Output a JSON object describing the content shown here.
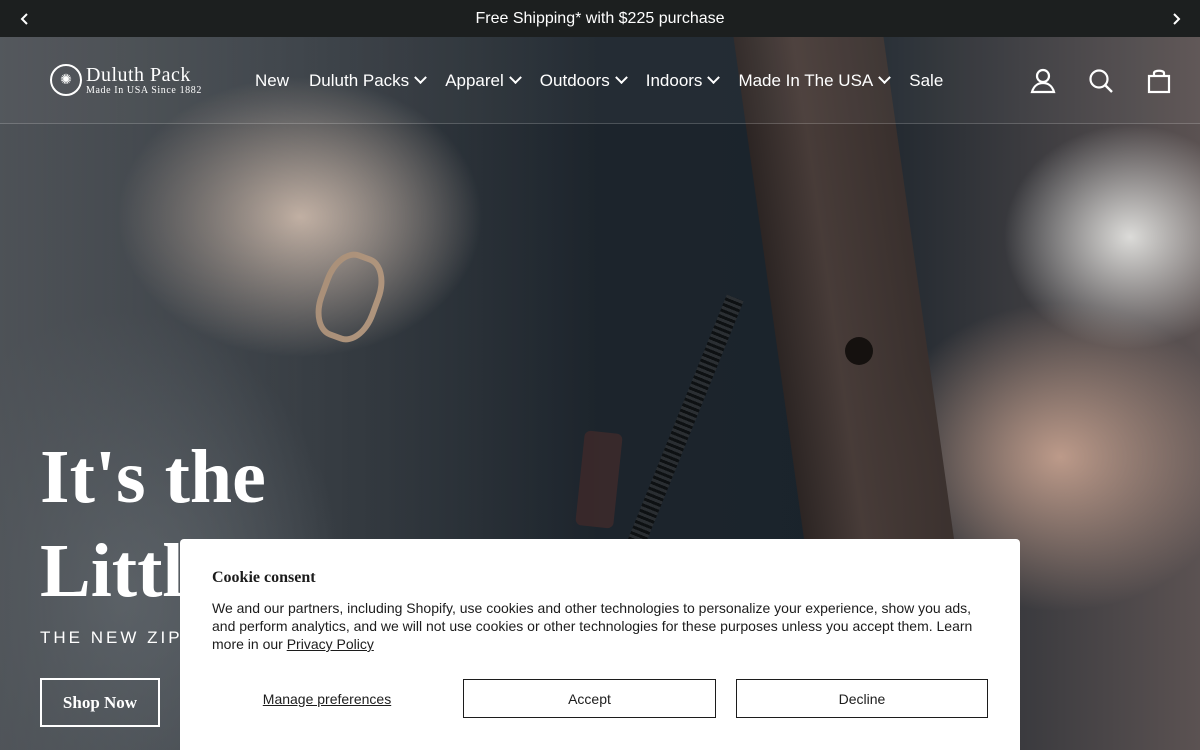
{
  "announcement": {
    "text": "Free Shipping* with $225 purchase",
    "prev_icon": "chevron-left-icon",
    "next_icon": "chevron-right-icon"
  },
  "header": {
    "logo": {
      "name": "Duluth Pack",
      "tagline": "Made In USA Since 1882"
    },
    "nav": [
      {
        "label": "New",
        "has_dropdown": false
      },
      {
        "label": "Duluth Packs",
        "has_dropdown": true
      },
      {
        "label": "Apparel",
        "has_dropdown": true
      },
      {
        "label": "Outdoors",
        "has_dropdown": true
      },
      {
        "label": "Indoors",
        "has_dropdown": true
      },
      {
        "label": "Made In The USA",
        "has_dropdown": true
      },
      {
        "label": "Sale",
        "has_dropdown": false
      }
    ],
    "icons": [
      "account-icon",
      "search-icon",
      "cart-icon"
    ]
  },
  "hero": {
    "title": "It's the\nLittl",
    "subtitle": "The New Zipp",
    "cta": "Shop Now"
  },
  "cookie": {
    "title": "Cookie consent",
    "body": "We and our partners, including Shopify, use cookies and other technologies to personalize your experience, show you ads, and perform analytics, and we will not use cookies or other technologies for these purposes unless you accept them. Learn more in our ",
    "policy_link": "Privacy Policy",
    "manage": "Manage preferences",
    "accept": "Accept",
    "decline": "Decline"
  },
  "colors": {
    "announcement_bg": "#1c1f1f",
    "text_light": "#ffffff",
    "modal_bg": "#ffffff",
    "modal_text": "#1c1c1c"
  }
}
